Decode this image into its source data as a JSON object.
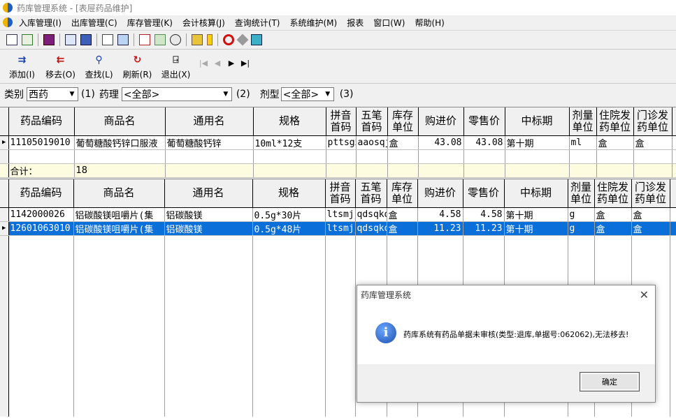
{
  "window": {
    "title": "药库管理系统 - [表屉药品维护]"
  },
  "menu": [
    "入库管理(I)",
    "出库管理(C)",
    "库存管理(K)",
    "会计核算(J)",
    "查询统计(T)",
    "系统维护(M)",
    "报表",
    "窗口(W)",
    "帮助(H)"
  ],
  "toolbar_actions": [
    {
      "label": "添加(I)",
      "icon": "add-icon"
    },
    {
      "label": "移去(O)",
      "icon": "remove-icon"
    },
    {
      "label": "查找(L)",
      "icon": "search-icon"
    },
    {
      "label": "刷新(R)",
      "icon": "refresh-icon"
    },
    {
      "label": "退出(X)",
      "icon": "exit-icon"
    }
  ],
  "filters": {
    "category_label": "类别",
    "category_value": "西药",
    "marker1": "(1)",
    "pharm_label": "药理",
    "pharm_value": "<全部>",
    "marker2": "(2)",
    "form_label": "剂型",
    "form_value": "<全部>",
    "marker3": "(3)"
  },
  "columns": [
    "药品编码",
    "商品名",
    "通用名",
    "规格",
    "拼音首码",
    "五笔首码",
    "库存单位",
    "购进价",
    "零售价",
    "中标期",
    "剂量单位",
    "住院发药单位",
    "门诊发药单位",
    "K/"
  ],
  "top_rows": [
    {
      "code": "11105019010",
      "trade_name": "葡萄糖酸钙锌口服液",
      "generic": "葡萄糖酸钙锌",
      "spec": "10ml*12支",
      "py": "pttsgxkfy",
      "wb": "aaosqjs",
      "unit": "盒",
      "buy": "43.08",
      "retail": "43.08",
      "period": "第十期",
      "dose": "ml",
      "inpat": "盒",
      "outpat": "盒"
    }
  ],
  "summary": {
    "label": "合计：",
    "value": "18"
  },
  "bottom_rows": [
    {
      "code": "1142000026",
      "trade_name": "铝碳酸镁咀嚼片(集",
      "generic": "铝碳酸镁",
      "spec": "0.5g*30片",
      "py": "ltsmjjp",
      "wb": "qdsqkdt",
      "unit": "盒",
      "buy": "4.58",
      "retail": "4.58",
      "period": "第十期",
      "dose": "g",
      "inpat": "盒",
      "outpat": "盒"
    },
    {
      "code": "12601063010",
      "trade_name": "铝碳酸镁咀嚼片(集",
      "generic": "铝碳酸镁",
      "spec": "0.5g*48片",
      "py": "ltsmjjp",
      "wb": "qdsqkdt",
      "unit": "盒",
      "buy": "11.23",
      "retail": "11.23",
      "period": "第十期",
      "dose": "g",
      "inpat": "盒",
      "outpat": "盒"
    }
  ],
  "dialog": {
    "title": "药库管理系统",
    "message": "药库系统有药品单据未审核(类型:退库,单据号:062062),无法移去!",
    "ok": "确定"
  }
}
